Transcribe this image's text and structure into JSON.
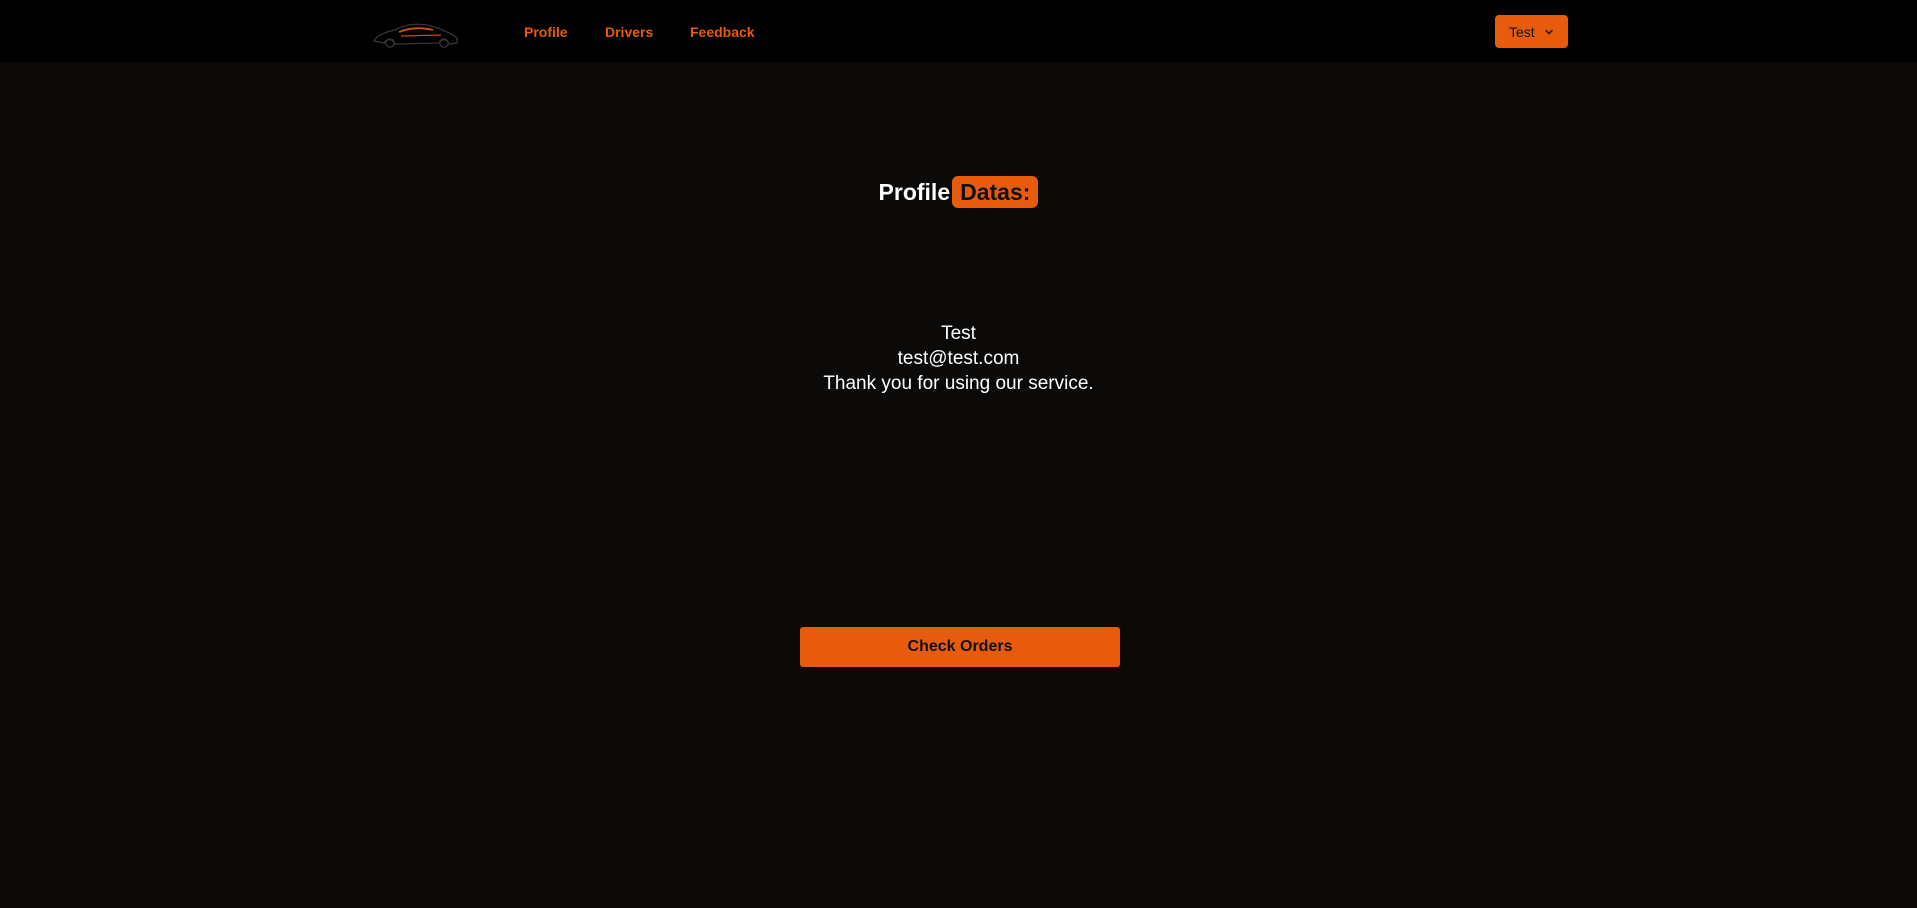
{
  "navbar": {
    "logo_icon": "sports-car-logo-icon",
    "links": [
      {
        "label": "Profile"
      },
      {
        "label": "Drivers"
      },
      {
        "label": "Feedback"
      }
    ],
    "user_menu": {
      "label": "Test",
      "icon": "chevron-down-icon"
    }
  },
  "profile": {
    "heading_prefix": "Profile",
    "heading_highlight": "Datas:",
    "name": "Test",
    "email": "test@test.com",
    "message": "Thank you for using our service."
  },
  "actions": {
    "check_orders_label": "Check Orders"
  },
  "colors": {
    "accent": "#e85a0c",
    "background": "#0b0a09",
    "navbar": "#000000",
    "text": "#ffffff"
  }
}
